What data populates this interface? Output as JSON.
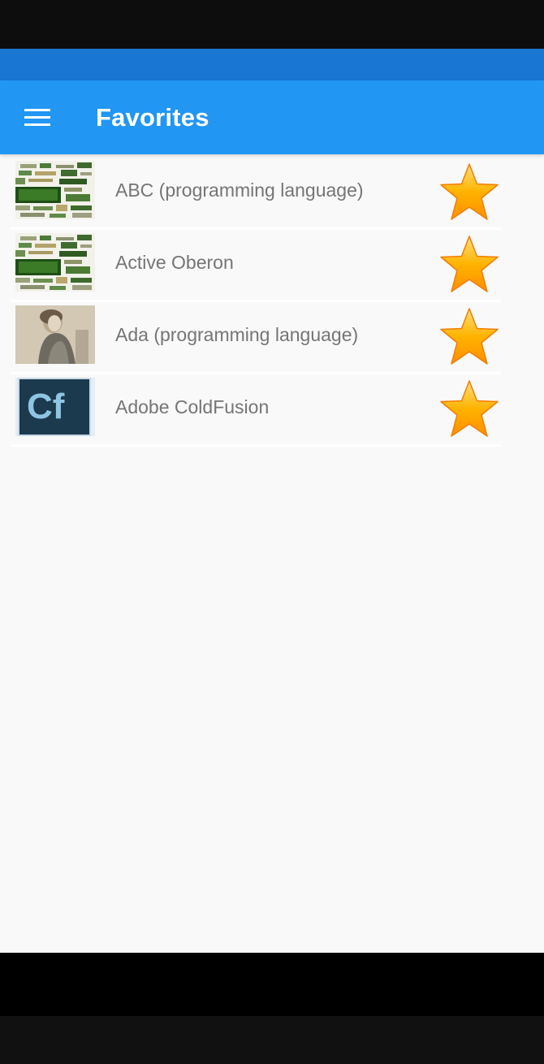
{
  "app": {
    "title": "Favorites"
  },
  "colors": {
    "app_bar": "#2196f3",
    "status_strip": "#1976d2",
    "background": "#f9f9f9",
    "label": "#757575",
    "star": "#ffa726"
  },
  "icons": {
    "menu": "hamburger-menu-icon",
    "favorite": "star-icon"
  },
  "favorites": [
    {
      "label": "ABC (programming language)",
      "thumbnail": "language-word-cloud"
    },
    {
      "label": "Active Oberon",
      "thumbnail": "language-word-cloud"
    },
    {
      "label": "Ada (programming language)",
      "thumbnail": "ada-lovelace-portrait"
    },
    {
      "label": "Adobe ColdFusion",
      "thumbnail": "coldfusion-logo",
      "logo_text": "Cf"
    }
  ]
}
